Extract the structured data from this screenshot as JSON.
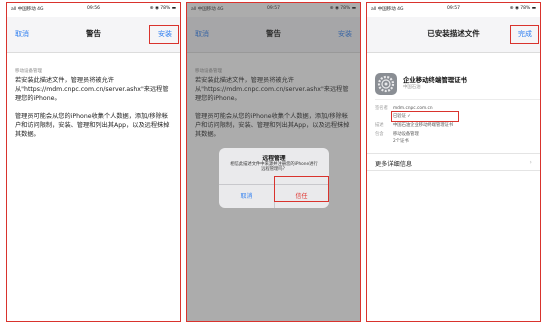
{
  "status_bar": {
    "signal": "all 中国移动 4G",
    "battery": "⊕ ◉ 78% ▬",
    "times": [
      "09:56",
      "09:57",
      "09:57"
    ]
  },
  "screen1": {
    "nav_left": "取消",
    "nav_title": "警告",
    "nav_right": "安装",
    "section_label": "移动设备管理",
    "para1": "若安装此描述文件，管理员将被允许从\"https://mdm.cnpc.com.cn/server.ashx\"来远程管理您的iPhone。",
    "para2": "管理员可能会从您的iPhone收集个人数据，添加/移除帐户和访问限制，安装、管理和列出其App，以及远程抹掉其数据。"
  },
  "screen2": {
    "nav_left": "取消",
    "nav_title": "警告",
    "nav_right": "安装",
    "section_label": "移动设备管理",
    "para1": "若安装此描述文件，管理员将被允许从\"https://mdm.cnpc.com.cn/server.ashx\"来远程管理您的iPhone。",
    "para2": "管理员可能会从您的iPhone收集个人数据，添加/移除帐户和访问限制，安装、管理和列出其App，以及远程抹掉其数据。",
    "alert": {
      "title": "远程管理",
      "message": "相信此描述文件中来源并注册您的iPhone进行远程管理吗？",
      "cancel": "取消",
      "confirm": "信任"
    }
  },
  "screen3": {
    "nav_title": "已安装描述文件",
    "nav_right": "完成",
    "profile_name": "企业移动终端管理证书",
    "profile_sub": "中国石油",
    "signed_key": "签名者",
    "signed_value": "mdm.cnpc.com.cn",
    "verified": "已验证 ✓",
    "desc_key": "描述",
    "desc_value": "中国石油企业移动终端管理证书",
    "contains_key": "包含",
    "contains_value": "移动设备管理",
    "contains_value2": "2个证书",
    "more_details": "更多详细信息",
    "chevron": "›"
  },
  "colors": {
    "accent": "#2f7ff0",
    "highlight": "#d9332d",
    "verified": "#2ea843"
  }
}
